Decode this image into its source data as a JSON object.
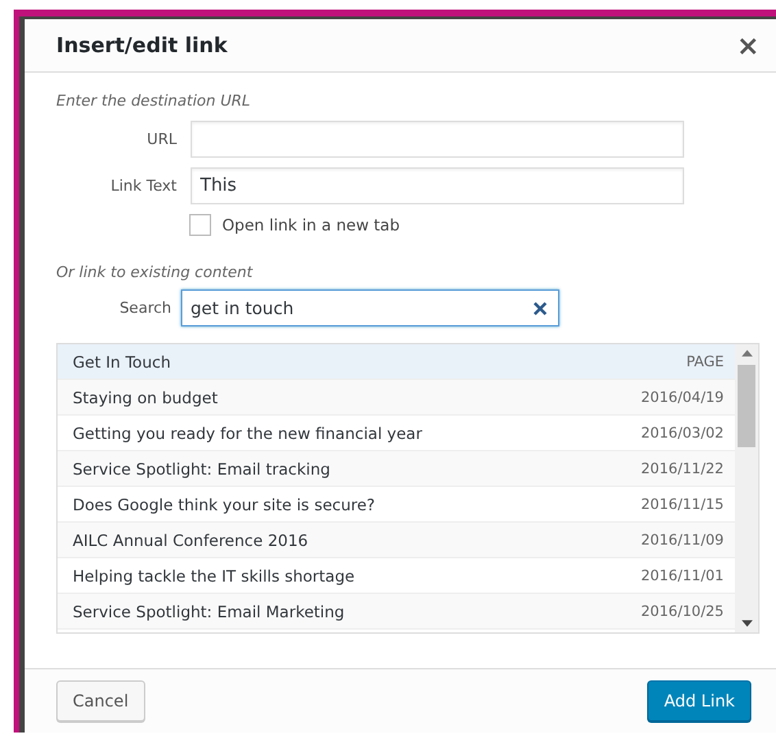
{
  "dialog": {
    "title": "Insert/edit link",
    "close": "×"
  },
  "url_section": {
    "heading": "Enter the destination URL",
    "fields": [
      {
        "label": "URL"
      },
      {
        "label": "Link Text",
        "value": "This"
      }
    ],
    "new_tab": {
      "label": "Open link in a new tab",
      "checked": false
    }
  },
  "search_section": {
    "heading": "Or link to existing content",
    "label": "Search",
    "value": "get in touch",
    "results": [
      {
        "title": "Get In Touch",
        "info": "PAGE",
        "selected": true
      },
      {
        "title": "Staying on budget",
        "info": "2016/04/19",
        "selected": false
      },
      {
        "title": "Getting you ready for the new financial year",
        "info": "2016/03/02",
        "selected": false
      },
      {
        "title": "Service Spotlight: Email tracking",
        "info": "2016/11/22",
        "selected": false
      },
      {
        "title": "Does Google think your site is secure?",
        "info": "2016/11/15",
        "selected": false
      },
      {
        "title": "AILC Annual Conference 2016",
        "info": "2016/11/09",
        "selected": false
      },
      {
        "title": "Helping tackle the IT skills shortage",
        "info": "2016/11/01",
        "selected": false
      },
      {
        "title": "Service Spotlight: Email Marketing",
        "info": "2016/10/25",
        "selected": false
      }
    ]
  },
  "buttons": {
    "cancel": "Cancel",
    "submit": "Add Link"
  }
}
